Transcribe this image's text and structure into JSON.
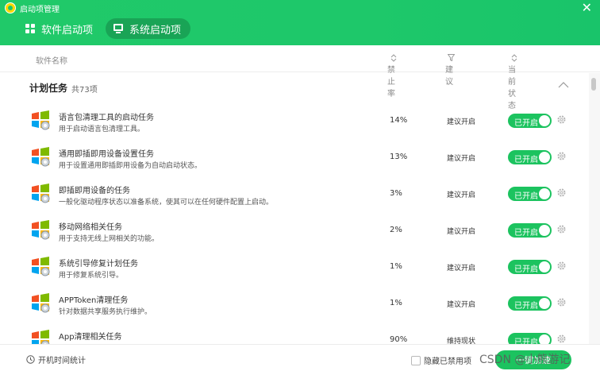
{
  "window": {
    "title": "启动项管理",
    "close_icon": "close-icon"
  },
  "tabs": [
    {
      "label": "软件启动项",
      "icon": "grid-icon",
      "active": false
    },
    {
      "label": "系统启动项",
      "icon": "monitor-icon",
      "active": true
    }
  ],
  "columns": {
    "name": "软件名称",
    "disable_rate": "禁止率",
    "advice": "建议",
    "status": "当前状态"
  },
  "group": {
    "title": "计划任务",
    "count": "共73项"
  },
  "rows": [
    {
      "name": "语言包清理工具的启动任务",
      "desc": "用于启动语言包清理工具。",
      "rate": "14%",
      "advice": "建议开启",
      "status": "已开启"
    },
    {
      "name": "通用即插即用设备设置任务",
      "desc": "用于设置通用即插即用设备为自动启动状态。",
      "rate": "13%",
      "advice": "建议开启",
      "status": "已开启"
    },
    {
      "name": "即插即用设备的任务",
      "desc": "一般化驱动程序状态以准备系统，使其可以在任何硬件配置上启动。",
      "rate": "3%",
      "advice": "建议开启",
      "status": "已开启"
    },
    {
      "name": "移动网络相关任务",
      "desc": "用于支持无线上网相关的功能。",
      "rate": "2%",
      "advice": "建议开启",
      "status": "已开启"
    },
    {
      "name": "系统引导修复计划任务",
      "desc": "用于修复系统引导。",
      "rate": "1%",
      "advice": "建议开启",
      "status": "已开启"
    },
    {
      "name": "APPToken清理任务",
      "desc": "针对数据共享服务执行维护。",
      "rate": "1%",
      "advice": "建议开启",
      "status": "已开启"
    },
    {
      "name": "App清理相关任务",
      "desc": "",
      "rate": "90%",
      "advice": "维持现状",
      "status": "已开启"
    }
  ],
  "footer": {
    "boot_time_label": "开机时间统计",
    "hide_disabled_label": "隐藏已禁用项",
    "button_label": "一键加速"
  },
  "watermark": "CSDN @小熊游记",
  "colors": {
    "brand_green": "#1ec86a",
    "toggle_green": "#1cc35f"
  }
}
